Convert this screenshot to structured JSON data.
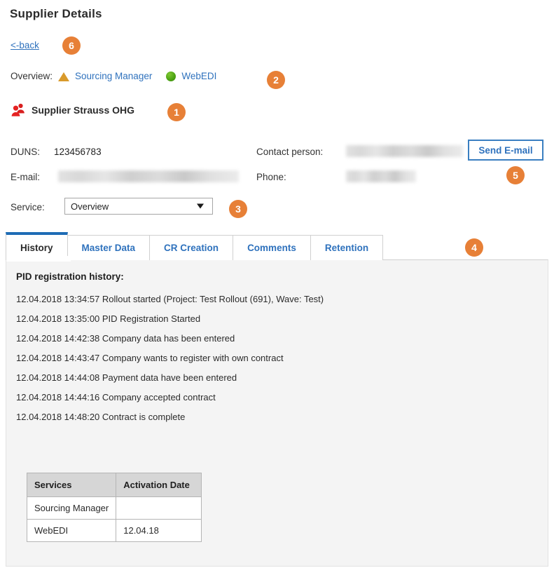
{
  "page": {
    "title": "Supplier Details",
    "back_link": "<-back"
  },
  "overview": {
    "label": "Overview:",
    "items": [
      {
        "label": "Sourcing Manager",
        "icon": "triangle-warning-icon",
        "status_color": "#d99a2b"
      },
      {
        "label": "WebEDI",
        "icon": "circle-green-icon",
        "status_color": "#4ba112"
      }
    ]
  },
  "supplier": {
    "name": "Supplier Strauss OHG",
    "icon": "people-icon"
  },
  "details": {
    "duns_label": "DUNS:",
    "duns_value": "123456783",
    "email_label": "E-mail:",
    "email_value": "",
    "contact_label": "Contact person:",
    "contact_value": "",
    "phone_label": "Phone:",
    "phone_value": "",
    "service_label": "Service:",
    "service_selected": "Overview",
    "service_options": [
      "Overview"
    ]
  },
  "actions": {
    "send_email_label": "Send E-mail"
  },
  "tabs": [
    {
      "label": "History",
      "active": true
    },
    {
      "label": "Master Data",
      "active": false
    },
    {
      "label": "CR Creation",
      "active": false
    },
    {
      "label": "Comments",
      "active": false
    },
    {
      "label": "Retention",
      "active": false
    }
  ],
  "history": {
    "title": "PID registration history:",
    "entries": [
      "12.04.2018 13:34:57 Rollout started (Project: Test Rollout (691), Wave: Test)",
      "12.04.2018 13:35:00 PID Registration Started",
      "12.04.2018 14:42:38 Company data has been entered",
      "12.04.2018 14:43:47 Company wants to register with own contract",
      "12.04.2018 14:44:08 Payment data have been entered",
      "12.04.2018 14:44:16 Company accepted contract",
      "12.04.2018 14:48:20 Contract is complete"
    ]
  },
  "services_table": {
    "headers": [
      "Services",
      "Activation Date"
    ],
    "rows": [
      {
        "service": "Sourcing Manager",
        "activation_date": ""
      },
      {
        "service": "WebEDI",
        "activation_date": "12.04.18"
      }
    ]
  },
  "callouts": [
    {
      "number": "1",
      "target": "supplier-name"
    },
    {
      "number": "2",
      "target": "overview-row"
    },
    {
      "number": "3",
      "target": "service-select"
    },
    {
      "number": "4",
      "target": "tabs"
    },
    {
      "number": "5",
      "target": "send-email-button"
    },
    {
      "number": "6",
      "target": "back-link"
    }
  ],
  "colors": {
    "badge": "#e78037",
    "link": "#2f72bd",
    "tab_active_border": "#1e6cb5",
    "panel_bg": "#f4f4f4",
    "table_header_bg": "#d6d6d6"
  }
}
